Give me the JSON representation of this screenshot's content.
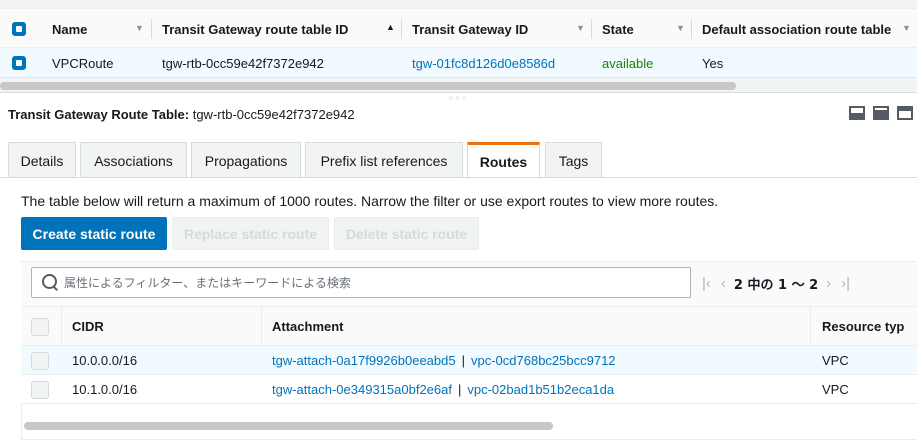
{
  "top_table": {
    "columns": [
      "Name",
      "Transit Gateway route table ID",
      "Transit Gateway ID",
      "State",
      "Default association route table"
    ],
    "row": {
      "name": "VPCRoute",
      "route_table_id": "tgw-rtb-0cc59e42f7372e942",
      "tgw_id": "tgw-01fc8d126d0e8586d",
      "state": "available",
      "default_association": "Yes"
    }
  },
  "detail": {
    "title_label": "Transit Gateway Route Table:",
    "title_value": "tgw-rtb-0cc59e42f7372e942"
  },
  "tabs": [
    {
      "label": "Details"
    },
    {
      "label": "Associations"
    },
    {
      "label": "Propagations"
    },
    {
      "label": "Prefix list references"
    },
    {
      "label": "Routes"
    },
    {
      "label": "Tags"
    }
  ],
  "active_tab": "Routes",
  "routes": {
    "info": "The table below will return a maximum of 1000 routes. Narrow the filter or use export routes to view more routes.",
    "buttons": {
      "create": "Create static route",
      "replace": "Replace static route",
      "delete": "Delete static route"
    },
    "search_placeholder": "属性によるフィルター、またはキーワードによる検索",
    "pager_text": "2 中の 1 〜 2",
    "columns": [
      "CIDR",
      "Attachment",
      "Resource typ"
    ],
    "rows": [
      {
        "cidr": "10.0.0.0/16",
        "attachment": "tgw-attach-0a17f9926b0eeabd5",
        "vpc": "vpc-0cd768bc25bcc9712",
        "resource_type": "VPC"
      },
      {
        "cidr": "10.1.0.0/16",
        "attachment": "tgw-attach-0e349315a0bf2e6af",
        "vpc": "vpc-02bad1b51b2eca1da",
        "resource_type": "VPC"
      }
    ]
  },
  "colors": {
    "link": "#0073bb",
    "primary_button": "#0073bb",
    "state_available": "#1d8102",
    "active_tab_accent": "#ec7211",
    "selected_row": "#f1faff"
  }
}
